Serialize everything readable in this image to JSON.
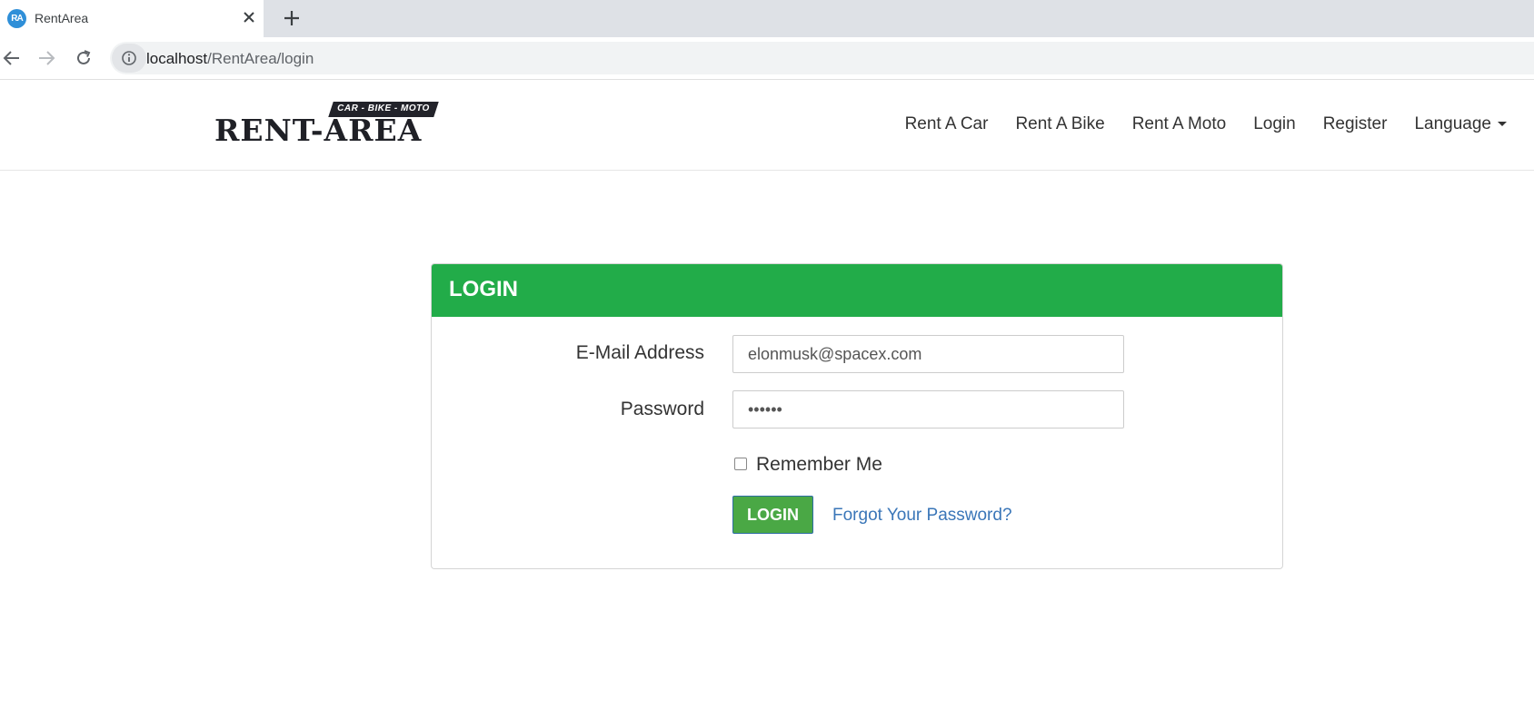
{
  "browser": {
    "tab_title": "RentArea",
    "favicon_text": "RA",
    "url_host": "localhost",
    "url_path": "/RentArea/login"
  },
  "site": {
    "logo_tagline": "CAR - BIKE - MOTO",
    "logo_text": "RENT-AREA",
    "nav": [
      "Rent A Car",
      "Rent A Bike",
      "Rent A Moto",
      "Login",
      "Register"
    ],
    "language_label": "Language"
  },
  "login": {
    "header": "LOGIN",
    "email_label": "E-Mail Address",
    "email_value": "elonmusk@spacex.com",
    "password_label": "Password",
    "password_value": "••••••",
    "remember_label": "Remember Me",
    "submit_label": "LOGIN",
    "forgot_label": "Forgot Your Password?"
  },
  "colors": {
    "brand_green": "#22ac49",
    "button_green": "#4aa845",
    "link_blue": "#3a76b8"
  }
}
